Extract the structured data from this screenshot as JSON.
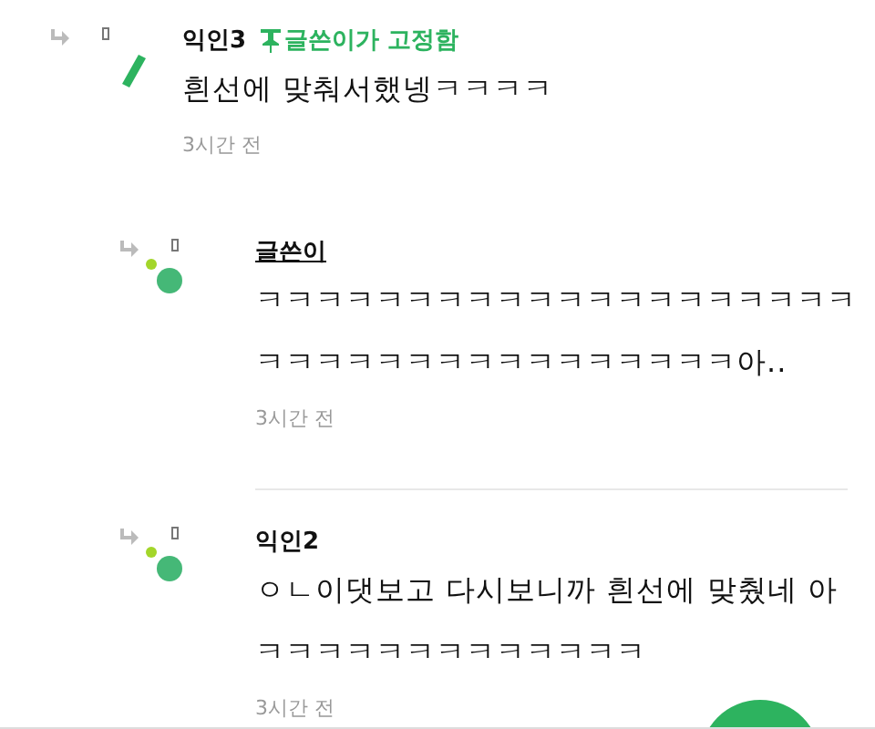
{
  "comments": [
    {
      "author": "익인3",
      "is_writer": false,
      "badge": "글쓴이가 고정함",
      "reply": false,
      "lines": [
        "흰선에 맞춰서했넹ㅋㅋㅋㅋ"
      ],
      "time": "3시간 전"
    },
    {
      "author": "글쓴이",
      "is_writer": true,
      "reply": true,
      "lines": [
        "ㅋㅋㅋㅋㅋㅋㅋㅋㅋㅋㅋㅋㅋㅋㅋㅋㅋㅋㅋㅋ",
        "ㅋㅋㅋㅋㅋㅋㅋㅋㅋㅋㅋㅋㅋㅋㅋㅋ아.."
      ],
      "time": "3시간 전"
    },
    {
      "author": "익인2",
      "is_writer": false,
      "reply": true,
      "lines": [
        "ㅇㄴ이댓보고 다시보니까 흰선에 맞췄네 아",
        "ㅋㅋㅋㅋㅋㅋㅋㅋㅋㅋㅋㅋㅋ"
      ],
      "time": "3시간 전"
    }
  ]
}
